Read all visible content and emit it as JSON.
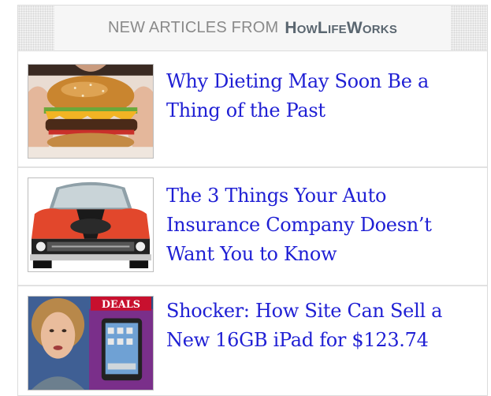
{
  "header": {
    "prefix": "NEW ARTICLES FROM",
    "brand": "HowLifeWorks"
  },
  "articles": [
    {
      "title": "Why Dieting May Soon Be a Thing of the Past",
      "thumb_icon": "burger-photo"
    },
    {
      "title": "The 3 Things Your Auto Insurance Company Doesn’t Want You to Know",
      "thumb_icon": "car-photo"
    },
    {
      "title": "Shocker: How Site Can Sell a New 16GB iPad for $123.74",
      "thumb_icon": "news-anchor-ipad-photo",
      "badge": "DEALS"
    }
  ],
  "colors": {
    "link": "#1f1fd4",
    "header_text": "#8a8a8a",
    "brand_text": "#5a6670",
    "car_red": "#e2472c",
    "deals_red": "#c8102e"
  }
}
